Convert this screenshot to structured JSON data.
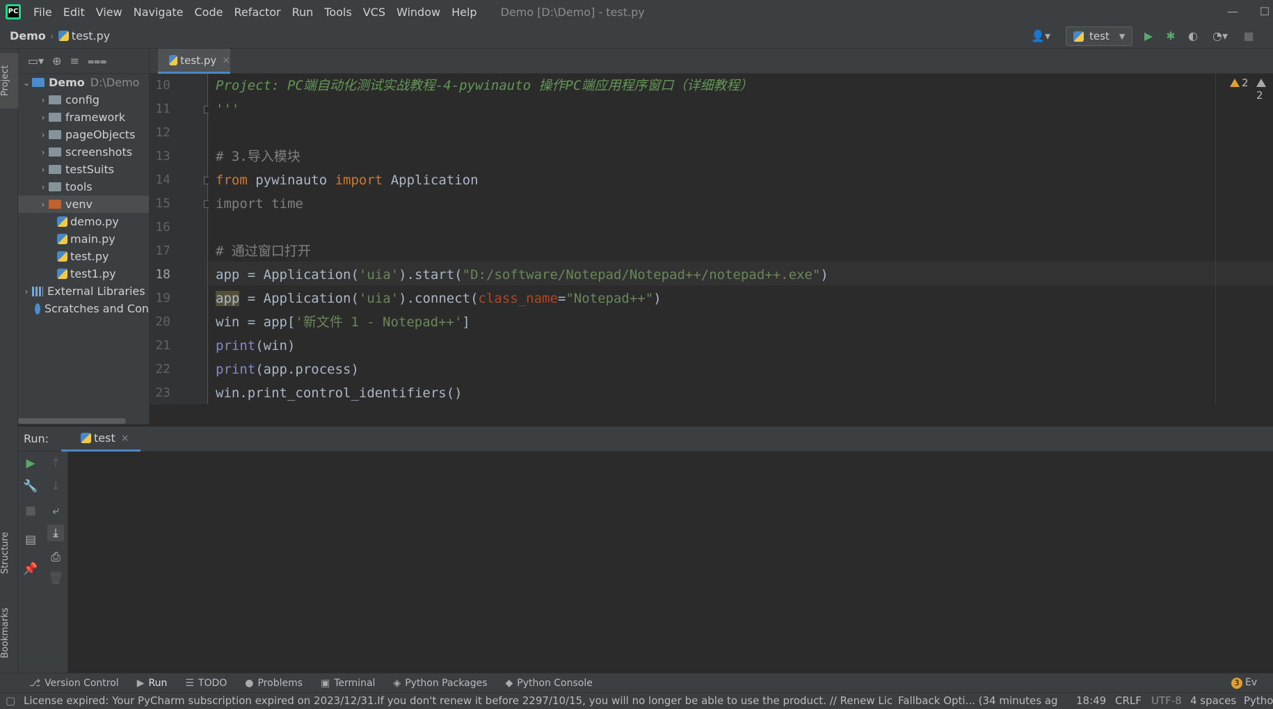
{
  "menubar": {
    "logo_text": "PC",
    "items": [
      "File",
      "Edit",
      "View",
      "Navigate",
      "Code",
      "Refactor",
      "Run",
      "Tools",
      "VCS",
      "Window",
      "Help"
    ],
    "window_title": "Demo [D:\\Demo] - test.py"
  },
  "breadcrumb": {
    "project": "Demo",
    "file": "test.py"
  },
  "toolbar": {
    "run_config": "test"
  },
  "left_strip": {
    "project_tab": "Project",
    "structure_tab": "Structure",
    "bookmarks_tab": "Bookmarks"
  },
  "project_tree": {
    "root": {
      "name": "Demo",
      "path": "D:\\Demo"
    },
    "items": [
      {
        "label": "config",
        "kind": "folder"
      },
      {
        "label": "framework",
        "kind": "folder"
      },
      {
        "label": "pageObjects",
        "kind": "folder"
      },
      {
        "label": "screenshots",
        "kind": "folder"
      },
      {
        "label": "testSuits",
        "kind": "folder"
      },
      {
        "label": "tools",
        "kind": "folder"
      },
      {
        "label": "venv",
        "kind": "folder-excluded"
      },
      {
        "label": "demo.py",
        "kind": "file"
      },
      {
        "label": "main.py",
        "kind": "file"
      },
      {
        "label": "test.py",
        "kind": "file"
      },
      {
        "label": "test1.py",
        "kind": "file"
      }
    ],
    "external_libraries": "External Libraries",
    "scratches": "Scratches and Con"
  },
  "editor": {
    "tab_label": "test.py",
    "lines": [
      {
        "num": "10",
        "tokens": [
          [
            "doc",
            "Project: PC端自动化测试实战教程-4-pywinauto 操作PC端应用程序窗口（详细教程）"
          ]
        ]
      },
      {
        "num": "11",
        "tokens": [
          [
            "doc",
            "'''"
          ]
        ]
      },
      {
        "num": "12",
        "tokens": []
      },
      {
        "num": "13",
        "tokens": [
          [
            "cmt",
            "# 3.导入模块"
          ]
        ]
      },
      {
        "num": "14",
        "tokens": [
          [
            "kw",
            "from"
          ],
          [
            "plain",
            " pywinauto "
          ],
          [
            "kw",
            "import"
          ],
          [
            "plain",
            " Application"
          ]
        ]
      },
      {
        "num": "15",
        "tokens": [
          [
            "gray",
            "import time"
          ]
        ]
      },
      {
        "num": "16",
        "tokens": []
      },
      {
        "num": "17",
        "tokens": [
          [
            "cmt",
            "# 通过窗口打开"
          ]
        ]
      },
      {
        "num": "18",
        "tokens": [
          [
            "plain",
            "app = Application("
          ],
          [
            "str",
            "'uia'"
          ],
          [
            "plain",
            ").start("
          ],
          [
            "str",
            "\"D:/software/Notepad/Notepad++/notepad++.exe\""
          ],
          [
            "plain",
            ")"
          ]
        ]
      },
      {
        "num": "19",
        "tokens": [
          [
            "hl",
            "app"
          ],
          [
            "plain",
            " = Application("
          ],
          [
            "str",
            "'uia'"
          ],
          [
            "plain",
            ").connect("
          ],
          [
            "param",
            "class_name"
          ],
          [
            "plain",
            "="
          ],
          [
            "str",
            "\"Notepad++\""
          ],
          [
            "plain",
            ")"
          ]
        ]
      },
      {
        "num": "20",
        "tokens": [
          [
            "plain",
            "win = app["
          ],
          [
            "str",
            "'新文件 1 - Notepad++'"
          ],
          [
            "plain",
            "]"
          ]
        ]
      },
      {
        "num": "21",
        "tokens": [
          [
            "builtin",
            "print"
          ],
          [
            "plain",
            "(win)"
          ]
        ]
      },
      {
        "num": "22",
        "tokens": [
          [
            "builtin",
            "print"
          ],
          [
            "plain",
            "(app.process)"
          ]
        ]
      },
      {
        "num": "23",
        "tokens": [
          [
            "plain",
            "win.print_control_identifiers()"
          ]
        ]
      }
    ],
    "current_line": "18",
    "warnings": [
      "2",
      "2"
    ]
  },
  "run_panel": {
    "label": "Run:",
    "tab_label": "test"
  },
  "bottom_tabs": [
    "Version Control",
    "Run",
    "TODO",
    "Problems",
    "Terminal",
    "Python Packages",
    "Python Console"
  ],
  "bottom_right_badge": "3",
  "bottom_right_text": "Ev",
  "statusbar": {
    "message": "License expired: Your PyCharm subscription expired on 2023/12/31.If you don't renew it before 2297/10/15, you will no longer be able to use the product. // Renew License",
    "fallback": "Fallback Opti... (34 minutes ag",
    "position": "18:49",
    "line_sep": "CRLF",
    "encoding": "UTF-8",
    "indent": "4 spaces",
    "interpreter": "Pytho"
  },
  "colors": {
    "accent": "#4a88c7",
    "run_green": "#59a869",
    "warning": "#e0a030"
  }
}
